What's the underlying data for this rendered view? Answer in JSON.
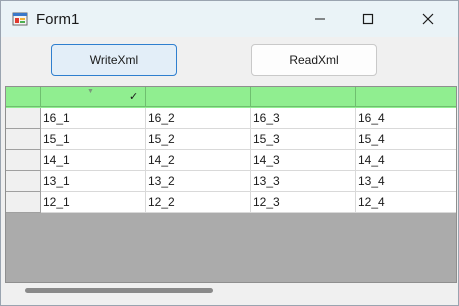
{
  "window": {
    "title": "Form1",
    "icon": "winforms-app-icon",
    "controls": [
      "minimize-icon",
      "maximize-icon",
      "close-icon"
    ]
  },
  "toolbar": {
    "write_label": "WriteXml",
    "read_label": "ReadXml"
  },
  "grid": {
    "header_color": "#90ee90",
    "sorted_column_checked": true,
    "rows": [
      [
        "16_1",
        "16_2",
        "16_3",
        "16_4"
      ],
      [
        "15_1",
        "15_2",
        "15_3",
        "15_4"
      ],
      [
        "14_1",
        "14_2",
        "14_3",
        "14_4"
      ],
      [
        "13_1",
        "13_2",
        "13_3",
        "13_4"
      ],
      [
        "12_1",
        "12_2",
        "12_3",
        "12_4"
      ]
    ]
  }
}
